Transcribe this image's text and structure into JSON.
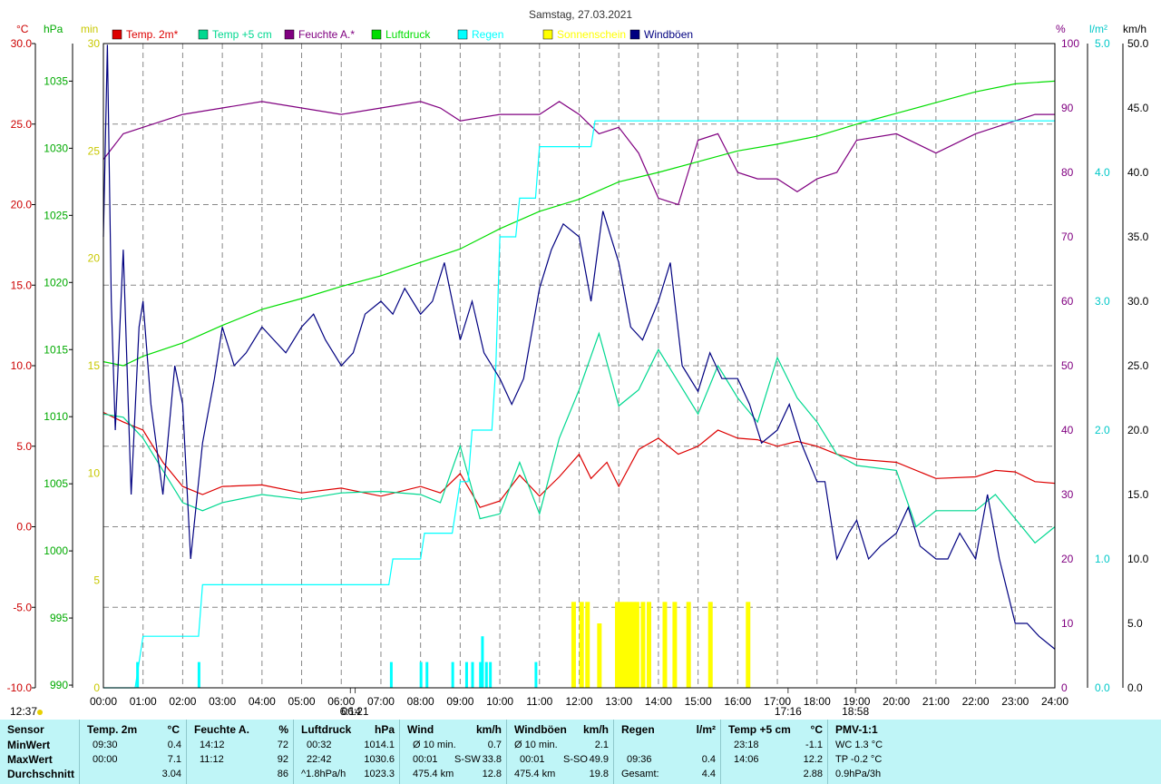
{
  "title": "Samstag, 27.03.2021",
  "chart_data": {
    "type": "line",
    "title": "Samstag, 27.03.2021",
    "x_ticks": [
      "00:00",
      "01:00",
      "02:00",
      "03:00",
      "04:00",
      "05:00",
      "06:00",
      "07:00",
      "08:00",
      "09:00",
      "10:00",
      "11:00",
      "12:00",
      "13:00",
      "14:00",
      "15:00",
      "16:00",
      "17:00",
      "18:00",
      "19:00",
      "20:00",
      "21:00",
      "22:00",
      "23:00",
      "24:00"
    ],
    "axes": {
      "temp": {
        "unit": "°C",
        "color": "#cc0000",
        "ticks": [
          "30.0",
          "25.0",
          "20.0",
          "15.0",
          "10.0",
          "5.0",
          "0.0",
          "-5.0",
          "-10.0"
        ],
        "range": [
          -10,
          30
        ]
      },
      "pressure": {
        "unit": "hPa",
        "color": "#00aa00",
        "ticks": [
          "1035",
          "1030",
          "1025",
          "1020",
          "1015",
          "1010",
          "1005",
          "1000",
          "995",
          "990"
        ],
        "range": [
          990,
          1030
        ]
      },
      "sun": {
        "unit": "min",
        "color": "#c8c800",
        "ticks": [
          "30",
          "25",
          "20",
          "15",
          "10",
          "5",
          "0"
        ],
        "range": [
          0,
          30
        ]
      },
      "humidity": {
        "unit": "%",
        "color": "#800080",
        "ticks": [
          "100",
          "90",
          "80",
          "70",
          "60",
          "50",
          "40",
          "30",
          "20",
          "10",
          "0"
        ],
        "range": [
          0,
          100
        ]
      },
      "rain": {
        "unit": "l/m²",
        "color": "#00c8c8",
        "ticks": [
          "5.0",
          "4.0",
          "3.0",
          "2.0",
          "1.0",
          "0.0"
        ],
        "range": [
          0,
          5
        ]
      },
      "wind": {
        "unit": "km/h",
        "color": "#000000",
        "ticks": [
          "50.0",
          "45.0",
          "40.0",
          "35.0",
          "30.0",
          "25.0",
          "20.0",
          "15.0",
          "10.0",
          "5.0",
          "0.0"
        ],
        "range": [
          0,
          50
        ]
      }
    },
    "legend": [
      {
        "name": "Temp. 2m*",
        "color": "#dd0000"
      },
      {
        "name": "Temp +5 cm",
        "color": "#00d890"
      },
      {
        "name": "Feuchte A.*",
        "color": "#800080"
      },
      {
        "name": "Luftdruck",
        "color": "#00dd00"
      },
      {
        "name": "Regen",
        "color": "#00ffff"
      },
      {
        "name": "Sonnenschein",
        "color": "#ffff00"
      },
      {
        "name": "Windböen",
        "color": "#000080"
      }
    ],
    "series": [
      {
        "name": "Temp. 2m*",
        "axis": "temp",
        "color": "#dd0000",
        "x": [
          0,
          0.5,
          1,
          1.5,
          2,
          2.5,
          3,
          4,
          5,
          6,
          7,
          8,
          8.5,
          9,
          9.5,
          10,
          10.5,
          11,
          11.5,
          12,
          12.3,
          12.7,
          13,
          13.5,
          14,
          14.5,
          15,
          15.5,
          16,
          16.5,
          17,
          17.5,
          18,
          18.5,
          19,
          20,
          21,
          22,
          22.5,
          23,
          23.5,
          24
        ],
        "y": [
          7.1,
          6.5,
          6.0,
          4.0,
          2.5,
          2.0,
          2.5,
          2.6,
          2.1,
          2.4,
          1.9,
          2.5,
          2.1,
          3.3,
          1.2,
          1.6,
          3.2,
          1.9,
          3.1,
          4.5,
          3.0,
          4.0,
          2.5,
          4.8,
          5.5,
          4.5,
          5.0,
          6.0,
          5.5,
          5.4,
          5.0,
          5.3,
          5.0,
          4.5,
          4.2,
          4.0,
          3.0,
          3.1,
          3.5,
          3.4,
          2.8,
          2.7
        ]
      },
      {
        "name": "Temp +5 cm",
        "axis": "temp",
        "color": "#00d890",
        "x": [
          0,
          0.5,
          1,
          1.5,
          2,
          2.5,
          3,
          4,
          5,
          6,
          7,
          8,
          8.5,
          9,
          9.5,
          10,
          10.5,
          11,
          11.5,
          12,
          12.5,
          13,
          13.5,
          14,
          14.5,
          15,
          15.5,
          16,
          16.5,
          17,
          17.5,
          18,
          18.5,
          19,
          20,
          20.5,
          21,
          22,
          22.5,
          23,
          23.5,
          24
        ],
        "y": [
          7.0,
          6.8,
          5.5,
          3.5,
          1.5,
          1.0,
          1.5,
          2.0,
          1.7,
          2.1,
          2.2,
          2.0,
          1.5,
          5.0,
          0.5,
          0.8,
          4.0,
          0.8,
          5.5,
          8.5,
          12.0,
          7.5,
          8.5,
          11.0,
          9.0,
          7.0,
          10.0,
          8.0,
          6.5,
          10.5,
          8.0,
          6.5,
          4.5,
          3.8,
          3.5,
          0.0,
          1.0,
          1.0,
          2.0,
          0.5,
          -1.0,
          0.0
        ]
      },
      {
        "name": "Feuchte A.*",
        "axis": "humidity",
        "color": "#800080",
        "x": [
          0,
          0.5,
          1,
          1.5,
          2,
          3,
          4,
          5,
          6,
          7,
          8,
          8.5,
          9,
          10,
          11,
          11.5,
          12,
          12.5,
          13,
          13.5,
          14,
          14.5,
          15,
          15.5,
          16,
          16.5,
          17,
          17.5,
          18,
          18.5,
          19,
          20,
          21,
          22,
          22.5,
          23,
          23.5,
          24
        ],
        "y": [
          82,
          86,
          87,
          88,
          89,
          90,
          91,
          90,
          89,
          90,
          91,
          90,
          88,
          89,
          89,
          91,
          89,
          86,
          87,
          83,
          76,
          75,
          85,
          86,
          80,
          79,
          79,
          77,
          79,
          80,
          85,
          86,
          83,
          86,
          87,
          88,
          89,
          89
        ]
      },
      {
        "name": "Luftdruck",
        "axis": "pressure",
        "color": "#00dd00",
        "x": [
          0,
          0.5,
          1,
          2,
          3,
          4,
          5,
          6,
          7,
          8,
          9,
          10,
          11,
          12,
          13,
          14,
          15,
          16,
          17,
          18,
          19,
          20,
          21,
          22,
          23,
          24
        ],
        "y": [
          1014.1,
          1013.8,
          1014.5,
          1015.5,
          1016.8,
          1018.0,
          1018.8,
          1019.7,
          1020.5,
          1021.5,
          1022.5,
          1024.0,
          1025.3,
          1026.2,
          1027.5,
          1028.2,
          1029.0,
          1029.8,
          1030.3,
          1030.9,
          1031.8,
          1032.6,
          1033.4,
          1034.2,
          1034.8,
          1035.0
        ]
      },
      {
        "name": "Regen",
        "axis": "rain",
        "color": "#00ffff",
        "x": [
          0,
          0.8,
          1.0,
          2.4,
          2.5,
          7.2,
          7.3,
          8.0,
          8.1,
          8.8,
          9.0,
          9.2,
          9.3,
          9.8,
          9.9,
          10.0,
          10.4,
          10.5,
          10.9,
          11.0,
          12.3,
          12.4,
          14.0,
          24.0
        ],
        "y": [
          0,
          0,
          0.4,
          0.4,
          0.8,
          0.8,
          1.0,
          1.0,
          1.2,
          1.2,
          1.6,
          1.6,
          2.0,
          2.0,
          2.5,
          3.5,
          3.5,
          3.8,
          3.8,
          4.2,
          4.2,
          4.4,
          4.4,
          4.4
        ]
      },
      {
        "name": "Windböen",
        "axis": "wind",
        "color": "#000080",
        "x": [
          0,
          0.1,
          0.2,
          0.3,
          0.5,
          0.7,
          0.9,
          1.0,
          1.2,
          1.5,
          1.8,
          2.0,
          2.2,
          2.5,
          2.8,
          3.0,
          3.3,
          3.6,
          4.0,
          4.3,
          4.6,
          5.0,
          5.3,
          5.6,
          6.0,
          6.3,
          6.6,
          7.0,
          7.3,
          7.6,
          8.0,
          8.3,
          8.6,
          9.0,
          9.3,
          9.6,
          10.0,
          10.3,
          10.6,
          11.0,
          11.3,
          11.6,
          12.0,
          12.3,
          12.6,
          13.0,
          13.3,
          13.6,
          14.0,
          14.3,
          14.6,
          15.0,
          15.3,
          15.6,
          16.0,
          16.3,
          16.6,
          17.0,
          17.3,
          17.6,
          18.0,
          18.2,
          18.5,
          18.8,
          19.0,
          19.3,
          19.6,
          20.0,
          20.3,
          20.6,
          21.0,
          21.3,
          21.6,
          22.0,
          22.3,
          22.6,
          23.0,
          23.3,
          23.6,
          24.0
        ],
        "y": [
          35,
          49.9,
          30,
          20,
          34,
          15,
          28,
          30,
          22,
          15,
          25,
          22,
          10,
          19,
          24,
          28,
          25,
          26,
          28,
          27,
          26,
          28,
          29,
          27,
          25,
          26,
          29,
          30,
          29,
          31,
          29,
          30,
          33,
          27,
          30,
          26,
          24,
          22,
          24,
          31,
          34,
          36,
          35,
          30,
          37,
          33,
          28,
          27,
          30,
          33,
          25,
          23,
          26,
          24,
          24,
          22,
          19,
          20,
          22,
          19,
          16,
          16,
          10,
          12,
          13,
          10,
          11,
          12,
          14,
          11,
          10,
          10,
          12,
          10,
          15,
          10,
          5,
          5,
          4,
          3
        ]
      }
    ],
    "sunshine_bars": [
      {
        "x": 11.85,
        "h": 4
      },
      {
        "x": 12.05,
        "h": 4
      },
      {
        "x": 12.2,
        "h": 4
      },
      {
        "x": 12.5,
        "h": 3
      },
      {
        "x": 12.95,
        "h": 4
      },
      {
        "x": 13.05,
        "h": 4
      },
      {
        "x": 13.15,
        "h": 4
      },
      {
        "x": 13.25,
        "h": 4
      },
      {
        "x": 13.35,
        "h": 4
      },
      {
        "x": 13.45,
        "h": 4
      },
      {
        "x": 13.6,
        "h": 4
      },
      {
        "x": 13.75,
        "h": 4
      },
      {
        "x": 14.15,
        "h": 4
      },
      {
        "x": 14.4,
        "h": 4
      },
      {
        "x": 14.75,
        "h": 4
      },
      {
        "x": 15.3,
        "h": 4
      },
      {
        "x": 16.25,
        "h": 4
      }
    ],
    "rain_bars": [
      {
        "x": 0.85,
        "h": 0.2
      },
      {
        "x": 2.4,
        "h": 0.2
      },
      {
        "x": 7.25,
        "h": 0.2
      },
      {
        "x": 8.0,
        "h": 0.2
      },
      {
        "x": 8.15,
        "h": 0.2
      },
      {
        "x": 8.8,
        "h": 0.2
      },
      {
        "x": 9.15,
        "h": 0.2
      },
      {
        "x": 9.3,
        "h": 0.2
      },
      {
        "x": 9.5,
        "h": 0.2
      },
      {
        "x": 9.55,
        "h": 0.4
      },
      {
        "x": 9.65,
        "h": 0.2
      },
      {
        "x": 9.75,
        "h": 0.2
      },
      {
        "x": 10.9,
        "h": 0.2
      }
    ],
    "markers": [
      {
        "label": "06:21",
        "x": 6.35
      },
      {
        "label": "6:14",
        "x": 6.23
      },
      {
        "label": "17:16",
        "x": 17.27
      },
      {
        "label": "18:58",
        "x": 18.97
      },
      {
        "label": "12:37",
        "x": -1
      }
    ]
  },
  "summary": {
    "sensor": {
      "header": "Sensor",
      "rows": [
        "MinWert",
        "MaxWert",
        "Durchschnitt"
      ]
    },
    "temp2m": {
      "header": "Temp. 2m",
      "unit": "°C",
      "min_time": "09:30",
      "min": "0.4",
      "max_time": "00:00",
      "max": "7.1",
      "avg": "3.04"
    },
    "humidity": {
      "header": "Feuchte A.",
      "unit": "%",
      "min_time": "14:12",
      "min": "72",
      "max_time": "11:12",
      "max": "92",
      "avg": "86"
    },
    "pressure": {
      "header": "Luftdruck",
      "unit": "hPa",
      "min_time": "00:32",
      "min": "1014.1",
      "max_time": "22:42",
      "max": "1030.6",
      "avg_label": "^1.8hPa/h",
      "avg": "1023.3"
    },
    "wind": {
      "header": "Wind",
      "unit": "km/h",
      "min_label": "Ø 10 min.",
      "min": "0.7",
      "max_time": "00:01",
      "max_dir": "S-SW",
      "max": "33.8",
      "avg_label": "475.4 km",
      "avg": "12.8"
    },
    "gusts": {
      "header": "Windböen",
      "unit": "km/h",
      "min_label": "Ø 10 min.",
      "min": "2.1",
      "max_time": "00:01",
      "max_dir": "S-SO",
      "max": "49.9",
      "avg_label": "475.4 km",
      "avg": "19.8"
    },
    "rain": {
      "header": "Regen",
      "unit": "l/m²",
      "max_time": "09:36",
      "max": "0.4",
      "avg_label": "Gesamt:",
      "avg": "4.4"
    },
    "temp5cm": {
      "header": "Temp +5 cm",
      "unit": "°C",
      "min_time": "23:18",
      "min": "-1.1",
      "max_time": "14:06",
      "max": "12.2",
      "avg": "2.88"
    },
    "pmv": {
      "header": "PMV-1:1",
      "row1": "WC 1.3 °C",
      "row2": "TP -0.2 °C",
      "row3": "0.9hPa/3h"
    }
  }
}
